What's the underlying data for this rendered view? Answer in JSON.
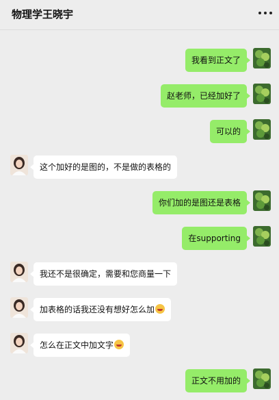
{
  "header": {
    "title": "物理学王晓宇",
    "more_icon": "more-dots-icon"
  },
  "messages": [
    {
      "sender": "me",
      "text": "我看到正文了"
    },
    {
      "sender": "me",
      "text": "赵老师，已经加好了"
    },
    {
      "sender": "me",
      "text": "可以的"
    },
    {
      "sender": "them",
      "text": "这个加好的是图的，不是做的表格的"
    },
    {
      "sender": "me",
      "text": "你们加的是图还是表格"
    },
    {
      "sender": "me",
      "text": "在supporting"
    },
    {
      "sender": "them",
      "text": "我还不是很确定，需要和您商量一下"
    },
    {
      "sender": "them",
      "text": "加表格的话我还没有想好怎么加",
      "emoji": "grimace-emoji"
    },
    {
      "sender": "them",
      "text": "怎么在正文中加文字",
      "emoji": "grimace-emoji"
    },
    {
      "sender": "me",
      "text": "正文不用加的"
    }
  ],
  "colors": {
    "background": "#ededed",
    "my_bubble": "#95ec69",
    "their_bubble": "#ffffff"
  }
}
